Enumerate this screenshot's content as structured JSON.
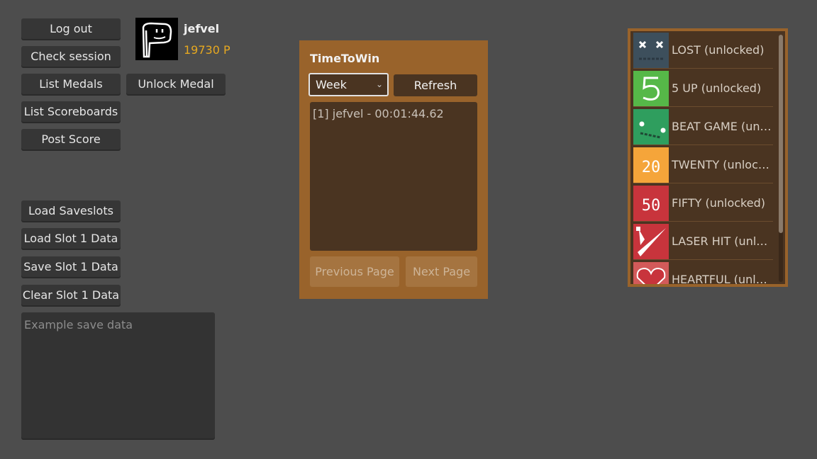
{
  "buttons": {
    "logout": "Log out",
    "check_session": "Check session",
    "list_medals": "List Medals",
    "unlock_medal": "Unlock Medal",
    "list_scoreboards": "List Scoreboards",
    "post_score": "Post Score",
    "load_saveslots": "Load Saveslots",
    "load_slot": "Load Slot 1 Data",
    "save_slot": "Save Slot 1 Data",
    "clear_slot": "Clear Slot 1 Data"
  },
  "user": {
    "name": "jefvel",
    "points": "19730 P",
    "avatar_icon": "doodle-face-icon"
  },
  "save_data": {
    "placeholder": "Example save data",
    "value": ""
  },
  "scoreboard": {
    "title": "TimeToWin",
    "period": "Week",
    "refresh": "Refresh",
    "entries": [
      "[1] jefvel - 00:01:44.62"
    ],
    "prev": "Previous Page",
    "next": "Next Page"
  },
  "medals": [
    {
      "label": "LOST (unlocked)",
      "icon": "x-eyes-icon",
      "color": "#3d4f5c"
    },
    {
      "label": "5 UP (unlocked)",
      "icon": "five-icon",
      "color": "#56b848"
    },
    {
      "label": "BEAT GAME (unlocked)",
      "icon": "smiley-icon",
      "color": "#2f9e5e"
    },
    {
      "label": "TWENTY (unlocked)",
      "icon": "twenty-icon",
      "color": "#f5a53a"
    },
    {
      "label": "FIFTY (unlocked)",
      "icon": "fifty-icon",
      "color": "#c8343c"
    },
    {
      "label": "LASER HIT (unlocked)",
      "icon": "laser-icon",
      "color": "#c8343c"
    },
    {
      "label": "HEARTFUL (unlocked)",
      "icon": "heart-icon",
      "color": "#c83c3c"
    }
  ]
}
